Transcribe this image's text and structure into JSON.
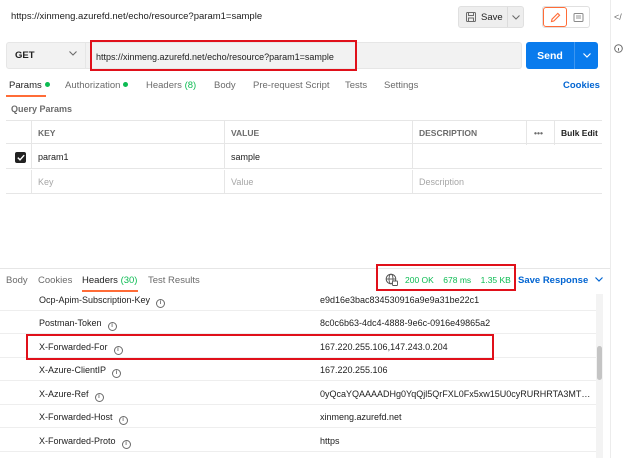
{
  "title_bar": {
    "url": "https://xinmeng.azurefd.net/echo/resource?param1=sample",
    "save_label": "Save"
  },
  "side_rail": {
    "code_label": "</"
  },
  "request": {
    "method": "GET",
    "url": "https://xinmeng.azurefd.net/echo/resource?param1=sample",
    "send_label": "Send"
  },
  "request_tabs": {
    "params": "Params",
    "authorization": "Authorization",
    "headers": "Headers",
    "headers_count": "(8)",
    "body": "Body",
    "pre_request": "Pre-request Script",
    "tests": "Tests",
    "settings": "Settings",
    "cookies": "Cookies"
  },
  "query_params": {
    "label": "Query Params",
    "columns": {
      "key": "KEY",
      "value": "VALUE",
      "description": "DESCRIPTION",
      "more": "•••",
      "bulk_edit": "Bulk Edit"
    },
    "rows": [
      {
        "key": "param1",
        "value": "sample",
        "description": ""
      }
    ],
    "placeholder": {
      "key": "Key",
      "value": "Value",
      "description": "Description"
    }
  },
  "response_tabs": {
    "body": "Body",
    "cookies": "Cookies",
    "headers": "Headers",
    "headers_count": "(30)",
    "test_results": "Test Results",
    "save_response": "Save Response"
  },
  "response_status": {
    "status": "200 OK",
    "time": "678 ms",
    "size": "1.35 KB"
  },
  "response_headers": [
    {
      "key": "Ocp-Apim-Subscription-Key",
      "value": "e9d16e3bac834530916a9e9a31be22c1"
    },
    {
      "key": "Postman-Token",
      "value": "8c0c6b63-4dc4-4888-9e6c-0916e49865a2"
    },
    {
      "key": "X-Forwarded-For",
      "value": "167.220.255.106,147.243.0.204"
    },
    {
      "key": "X-Azure-ClientIP",
      "value": "167.220.255.106"
    },
    {
      "key": "X-Azure-Ref",
      "value": "0yQcaYQAAAADHg0YqQjl5QrFXL0Fx5xw15U0cyRURHRTA3MTEA..."
    },
    {
      "key": "X-Forwarded-Host",
      "value": "xinmeng.azurefd.net"
    },
    {
      "key": "X-Forwarded-Proto",
      "value": "https"
    }
  ],
  "colors": {
    "accent_orange": "#ff6c37",
    "send_blue": "#097bed",
    "link_blue": "#0265d2",
    "status_green": "#0cbb52",
    "highlight_red": "#e0101a"
  }
}
